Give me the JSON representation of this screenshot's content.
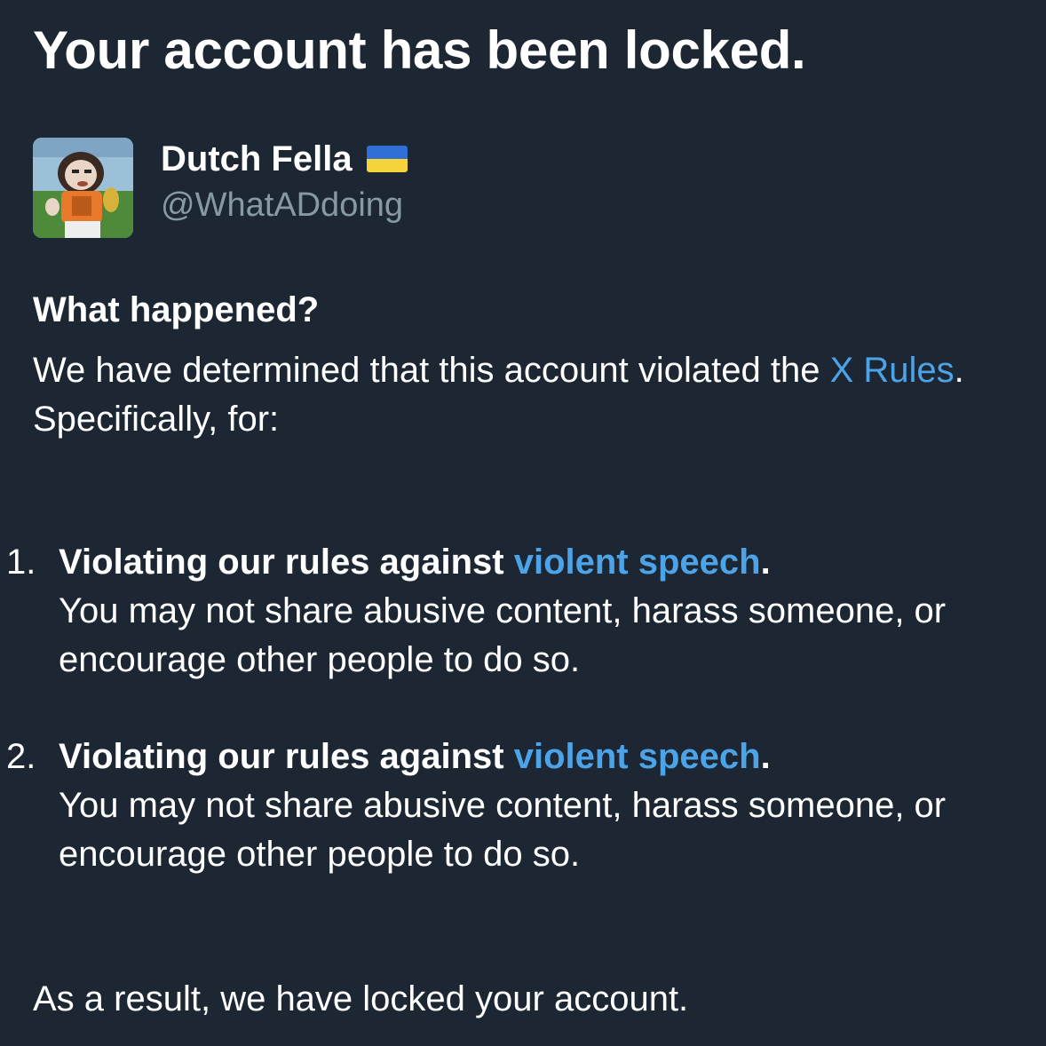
{
  "title": "Your account has been locked.",
  "profile": {
    "display_name": "Dutch Fella",
    "handle": "@WhatADdoing",
    "flag": "ukraine-flag"
  },
  "what_happened": {
    "heading": "What happened?",
    "intro_before": "We have determined that this account violated the ",
    "rules_link": "X Rules",
    "intro_after": ".",
    "intro_line2": "Specifically, for:"
  },
  "violations": [
    {
      "number": "1.",
      "head_before": "Violating our rules against ",
      "head_link": "violent speech",
      "head_after": ".",
      "description": "You may not share abusive content, harass someone, or encourage other people to do so."
    },
    {
      "number": "2.",
      "head_before": "Violating our rules against ",
      "head_link": "violent speech",
      "head_after": ".",
      "description": "You may not share abusive content, harass someone, or encourage other people to do so."
    }
  ],
  "result": "As a result, we have locked your account.",
  "colors": {
    "background": "#1c2733",
    "text": "#ffffff",
    "muted": "#8899a6",
    "link": "#4da3e8"
  }
}
